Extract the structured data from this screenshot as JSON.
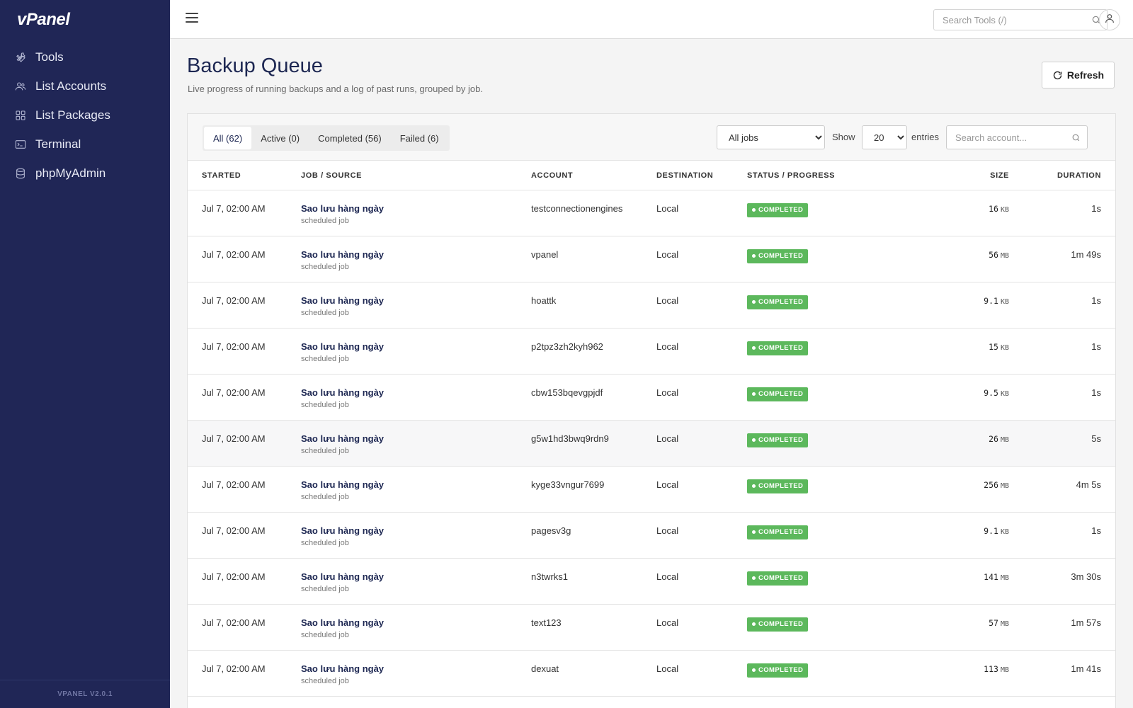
{
  "brand": {
    "logo": "vPanel",
    "version": "VPANEL V2.0.1"
  },
  "sidebar": {
    "items": [
      {
        "label": "Tools",
        "icon": "wrench-icon"
      },
      {
        "label": "List Accounts",
        "icon": "users-icon"
      },
      {
        "label": "List Packages",
        "icon": "grid-icon"
      },
      {
        "label": "Terminal",
        "icon": "terminal-icon"
      },
      {
        "label": "phpMyAdmin",
        "icon": "database-icon"
      }
    ]
  },
  "topbar": {
    "search_placeholder": "Search Tools (/)"
  },
  "page": {
    "title": "Backup Queue",
    "subtitle": "Live progress of running backups and a log of past runs, grouped by job.",
    "refresh_label": "Refresh"
  },
  "filters": {
    "tabs": [
      {
        "label": "All (62)",
        "active": true
      },
      {
        "label": "Active (0)",
        "active": false
      },
      {
        "label": "Completed (56)",
        "active": false
      },
      {
        "label": "Failed (6)",
        "active": false
      }
    ],
    "job_select": "All jobs",
    "show_label": "Show",
    "entries_value": "20",
    "entries_label": "entries",
    "account_search_placeholder": "Search account..."
  },
  "table": {
    "columns": [
      "STARTED",
      "JOB / SOURCE",
      "ACCOUNT",
      "DESTINATION",
      "STATUS / PROGRESS",
      "SIZE",
      "DURATION"
    ],
    "rows": [
      {
        "started": "Jul 7, 02:00 AM",
        "job": "Sao lưu hàng ngày",
        "source": "scheduled job",
        "account": "testconnectionengines",
        "destination": "Local",
        "status": "COMPLETED",
        "size": "16",
        "unit": "KB",
        "duration": "1s"
      },
      {
        "started": "Jul 7, 02:00 AM",
        "job": "Sao lưu hàng ngày",
        "source": "scheduled job",
        "account": "vpanel",
        "destination": "Local",
        "status": "COMPLETED",
        "size": "56",
        "unit": "MB",
        "duration": "1m 49s"
      },
      {
        "started": "Jul 7, 02:00 AM",
        "job": "Sao lưu hàng ngày",
        "source": "scheduled job",
        "account": "hoattk",
        "destination": "Local",
        "status": "COMPLETED",
        "size": "9.1",
        "unit": "KB",
        "duration": "1s"
      },
      {
        "started": "Jul 7, 02:00 AM",
        "job": "Sao lưu hàng ngày",
        "source": "scheduled job",
        "account": "p2tpz3zh2kyh962",
        "destination": "Local",
        "status": "COMPLETED",
        "size": "15",
        "unit": "KB",
        "duration": "1s"
      },
      {
        "started": "Jul 7, 02:00 AM",
        "job": "Sao lưu hàng ngày",
        "source": "scheduled job",
        "account": "cbw153bqevgpjdf",
        "destination": "Local",
        "status": "COMPLETED",
        "size": "9.5",
        "unit": "KB",
        "duration": "1s"
      },
      {
        "started": "Jul 7, 02:00 AM",
        "job": "Sao lưu hàng ngày",
        "source": "scheduled job",
        "account": "g5w1hd3bwq9rdn9",
        "destination": "Local",
        "status": "COMPLETED",
        "size": "26",
        "unit": "MB",
        "duration": "5s"
      },
      {
        "started": "Jul 7, 02:00 AM",
        "job": "Sao lưu hàng ngày",
        "source": "scheduled job",
        "account": "kyge33vngur7699",
        "destination": "Local",
        "status": "COMPLETED",
        "size": "256",
        "unit": "MB",
        "duration": "4m 5s"
      },
      {
        "started": "Jul 7, 02:00 AM",
        "job": "Sao lưu hàng ngày",
        "source": "scheduled job",
        "account": "pagesv3g",
        "destination": "Local",
        "status": "COMPLETED",
        "size": "9.1",
        "unit": "KB",
        "duration": "1s"
      },
      {
        "started": "Jul 7, 02:00 AM",
        "job": "Sao lưu hàng ngày",
        "source": "scheduled job",
        "account": "n3twrks1",
        "destination": "Local",
        "status": "COMPLETED",
        "size": "141",
        "unit": "MB",
        "duration": "3m 30s"
      },
      {
        "started": "Jul 7, 02:00 AM",
        "job": "Sao lưu hàng ngày",
        "source": "scheduled job",
        "account": "text123",
        "destination": "Local",
        "status": "COMPLETED",
        "size": "57",
        "unit": "MB",
        "duration": "1m 57s"
      },
      {
        "started": "Jul 7, 02:00 AM",
        "job": "Sao lưu hàng ngày",
        "source": "scheduled job",
        "account": "dexuat",
        "destination": "Local",
        "status": "COMPLETED",
        "size": "113",
        "unit": "MB",
        "duration": "1m 41s"
      }
    ]
  },
  "colors": {
    "sidebar": "#202656",
    "accent": "#1d2752",
    "success": "#5cb85c"
  }
}
